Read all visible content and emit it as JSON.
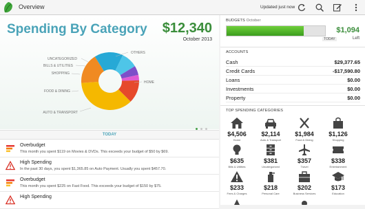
{
  "app": {
    "title": "Overview",
    "status": "Updated just now"
  },
  "actionbar": {
    "icons": [
      "refresh-icon",
      "search-icon",
      "edit-icon",
      "overflow-menu-icon"
    ]
  },
  "overview": {
    "title": "Spending By Category",
    "total": "$12,340",
    "period": "October 2013",
    "pie_labels": {
      "others": "OTHERS",
      "uncategorized": "UNCATEGORIZED",
      "bills": "BILLS & UTILITIES",
      "shopping": "SHOPPING",
      "food": "FOOD & DINING",
      "auto": "AUTO & TRANSPORT",
      "home": "HOME"
    },
    "pie_slices": [
      {
        "name": "Home",
        "value": 4506,
        "color": "#f5b800"
      },
      {
        "name": "Auto & Transport",
        "value": 2114,
        "color": "#f08a22"
      },
      {
        "name": "Food & Dining",
        "value": 1984,
        "color": "#27a9d6"
      },
      {
        "name": "Shopping",
        "value": 1126,
        "color": "#4ec5e8"
      },
      {
        "name": "Bills & Utilities",
        "value": 635,
        "color": "#7d4fc9"
      },
      {
        "name": "Uncategorized",
        "value": 381,
        "color": "#e05ad2"
      },
      {
        "name": "Others",
        "value": 1594,
        "color": "#e6492b"
      }
    ]
  },
  "today": {
    "label": "TODAY"
  },
  "alerts": [
    {
      "icon": "overbudget-icon",
      "title": "Overbudget",
      "desc": "This month you spent $119 on Movies & DVDs. This exceeds your budget of $50 by $69."
    },
    {
      "icon": "warning-icon",
      "title": "High Spending",
      "desc": "In the past 30 days, you spent $1,365.85 on Auto Payment.  Usually you spent $457.70."
    },
    {
      "icon": "overbudget-icon",
      "title": "Overbudget",
      "desc": "This month you spent $225 on Fast Food. This exceeds your budget of $150 by $75."
    },
    {
      "icon": "warning-icon",
      "title": "High Spending",
      "desc": ""
    }
  ],
  "budgets": {
    "heading": "BUDGETS",
    "period": "October",
    "amount": "$1,094",
    "left_label": "Left",
    "today_marker": "TODAY",
    "fill_fraction": 0.78
  },
  "accounts": {
    "heading": "ACCOUNTS",
    "rows": [
      {
        "name": "Cash",
        "value": "$29,377.65"
      },
      {
        "name": "Credit Cards",
        "value": "-$17,590.80"
      },
      {
        "name": "Loans",
        "value": "$0.00"
      },
      {
        "name": "Investments",
        "value": "$0.00"
      },
      {
        "name": "Property",
        "value": "$0.00"
      }
    ]
  },
  "top_spending": {
    "heading": "TOP SPENDING CATEGORIES",
    "items": [
      {
        "icon": "home-icon",
        "amount": "$4,506",
        "label": "Home"
      },
      {
        "icon": "car-icon",
        "amount": "$2,114",
        "label": "Auto & Transport"
      },
      {
        "icon": "fork-knife-icon",
        "amount": "$1,984",
        "label": "Food & Dining"
      },
      {
        "icon": "shopping-bag-icon",
        "amount": "$1,126",
        "label": "Shopping"
      },
      {
        "icon": "lightbulb-icon",
        "amount": "$635",
        "label": "Bills & Utilities"
      },
      {
        "icon": "file-cabinet-icon",
        "amount": "$381",
        "label": "Uncategorized"
      },
      {
        "icon": "airplane-icon",
        "amount": "$357",
        "label": "Travel"
      },
      {
        "icon": "ticket-icon",
        "amount": "$338",
        "label": "Entertainment"
      },
      {
        "icon": "warning-icon",
        "amount": "$233",
        "label": "Fees & Charges"
      },
      {
        "icon": "personal-care-icon",
        "amount": "$218",
        "label": "Personal Care"
      },
      {
        "icon": "briefcase-icon",
        "amount": "$202",
        "label": "Business Services"
      },
      {
        "icon": "graduation-cap-icon",
        "amount": "$173",
        "label": "Education"
      }
    ]
  },
  "colors": {
    "brand_green": "#3a8d3a",
    "accent_teal": "#4aa3b8",
    "alert_red": "#d93025"
  }
}
